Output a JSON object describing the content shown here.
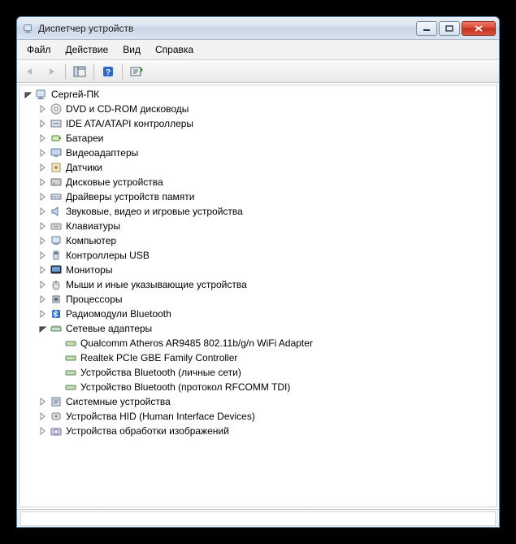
{
  "window": {
    "title": "Диспетчер устройств"
  },
  "menu": {
    "file": "Файл",
    "action": "Действие",
    "view": "Вид",
    "help": "Справка"
  },
  "tree": {
    "root": "Сергей-ПК",
    "categories": [
      {
        "label": "DVD и CD-ROM дисководы",
        "expanded": false,
        "icon": "disc"
      },
      {
        "label": "IDE ATA/ATAPI контроллеры",
        "expanded": false,
        "icon": "ide"
      },
      {
        "label": "Батареи",
        "expanded": false,
        "icon": "battery"
      },
      {
        "label": "Видеоадаптеры",
        "expanded": false,
        "icon": "display"
      },
      {
        "label": "Датчики",
        "expanded": false,
        "icon": "sensor"
      },
      {
        "label": "Дисковые устройства",
        "expanded": false,
        "icon": "disk"
      },
      {
        "label": "Драйверы устройств памяти",
        "expanded": false,
        "icon": "memdrv"
      },
      {
        "label": "Звуковые, видео и игровые устройства",
        "expanded": false,
        "icon": "sound"
      },
      {
        "label": "Клавиатуры",
        "expanded": false,
        "icon": "keyboard"
      },
      {
        "label": "Компьютер",
        "expanded": false,
        "icon": "computer"
      },
      {
        "label": "Контроллеры USB",
        "expanded": false,
        "icon": "usb"
      },
      {
        "label": "Мониторы",
        "expanded": false,
        "icon": "monitor"
      },
      {
        "label": "Мыши и иные указывающие устройства",
        "expanded": false,
        "icon": "mouse"
      },
      {
        "label": "Процессоры",
        "expanded": false,
        "icon": "cpu"
      },
      {
        "label": "Радиомодули Bluetooth",
        "expanded": false,
        "icon": "bluetooth"
      },
      {
        "label": "Сетевые адаптеры",
        "expanded": true,
        "icon": "network",
        "children": [
          {
            "label": "Qualcomm Atheros AR9485 802.11b/g/n WiFi Adapter",
            "icon": "netcard"
          },
          {
            "label": "Realtek PCIe GBE Family Controller",
            "icon": "netcard"
          },
          {
            "label": "Устройства Bluetooth (личные сети)",
            "icon": "netcard"
          },
          {
            "label": "Устройство Bluetooth (протокол RFCOMM TDI)",
            "icon": "netcard"
          }
        ]
      },
      {
        "label": "Системные устройства",
        "expanded": false,
        "icon": "system"
      },
      {
        "label": "Устройства HID (Human Interface Devices)",
        "expanded": false,
        "icon": "hid"
      },
      {
        "label": "Устройства обработки изображений",
        "expanded": false,
        "icon": "imaging"
      }
    ]
  }
}
